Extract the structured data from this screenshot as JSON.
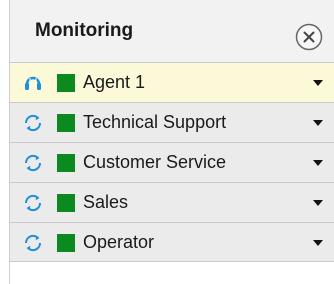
{
  "panel": {
    "title": "Monitoring",
    "close_icon": "close-circle-icon"
  },
  "rows": [
    {
      "label": "Agent 1",
      "icon": "headset-icon",
      "status_color": "#0c8a1f",
      "active": true
    },
    {
      "label": "Technical Support",
      "icon": "refresh-icon",
      "status_color": "#0c8a1f",
      "active": false
    },
    {
      "label": "Customer Service",
      "icon": "refresh-icon",
      "status_color": "#0c8a1f",
      "active": false
    },
    {
      "label": "Sales",
      "icon": "refresh-icon",
      "status_color": "#0c8a1f",
      "active": false
    },
    {
      "label": "Operator",
      "icon": "refresh-icon",
      "status_color": "#0c8a1f",
      "active": false
    }
  ],
  "colors": {
    "accent": "#1e8fd8",
    "status_ready": "#0c8a1f",
    "active_row": "#fbf9d8"
  }
}
